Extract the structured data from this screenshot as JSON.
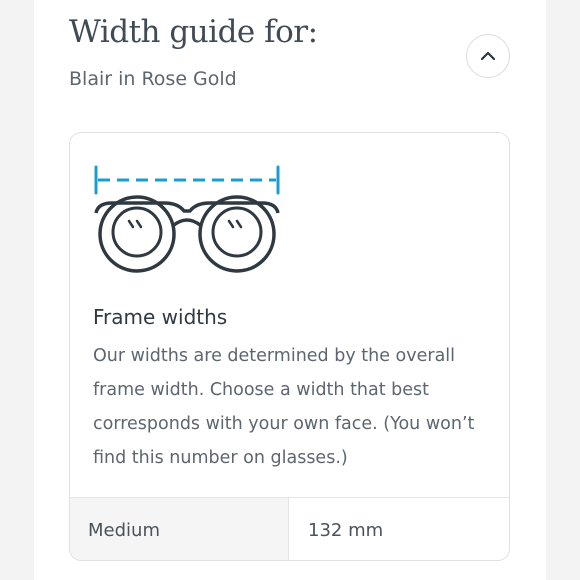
{
  "header": {
    "title": "Width guide for:",
    "subtitle": "Blair in Rose Gold",
    "collapse_icon": "chevron-up-icon"
  },
  "card": {
    "illustration_icon": "glasses-width-icon",
    "accent_color": "#1a9bd1",
    "heading": "Frame widths",
    "description": "Our widths are determined by the overall frame width. Choose a width that best corresponds with your own face. (You won’t find this number on glasses.)"
  },
  "size_table": {
    "label": "Medium",
    "value": "132 mm"
  }
}
